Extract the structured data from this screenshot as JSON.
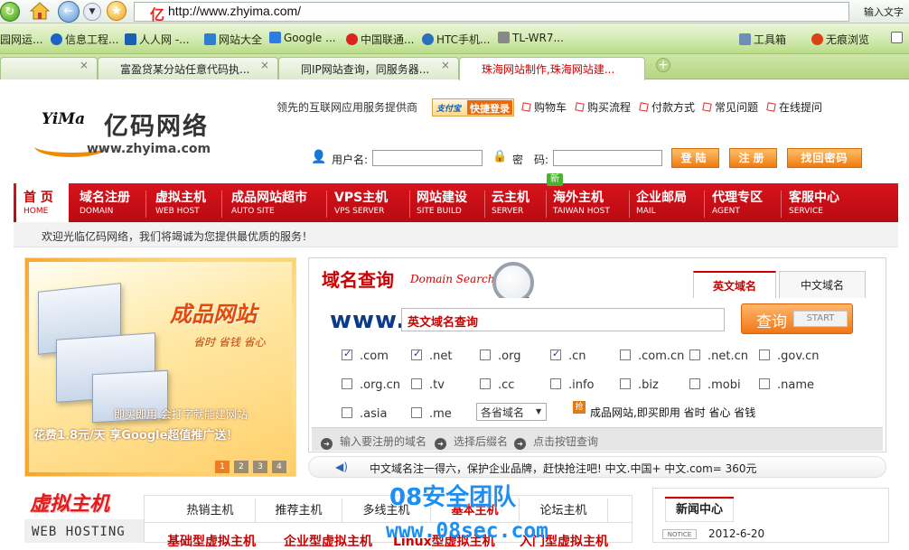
{
  "browser": {
    "url_logo": "亿",
    "url": "http://www.zhyima.com/",
    "search_hint": "输入文字",
    "bookmarks": [
      {
        "label": "园网运...",
        "color": "#2f8fd6"
      },
      {
        "label": "信息工程...",
        "color": "#1d62c6"
      },
      {
        "label": "人人网 -...",
        "color": "#1a5fb4"
      },
      {
        "label": "网站大全",
        "color": "#2d7fd0"
      },
      {
        "label": "Google ...",
        "color": "#2f7be6"
      },
      {
        "label": "中国联通...",
        "color": "#d9251d"
      },
      {
        "label": "HTC手机...",
        "color": "#2b6fbf"
      },
      {
        "label": "TL-WR7...",
        "color": "#888888"
      },
      {
        "label": "工具箱",
        "color": "#6e8fb3"
      },
      {
        "label": "无痕浏览",
        "color": "#d84315"
      }
    ],
    "tabs": [
      {
        "label": "",
        "active": false
      },
      {
        "label": "富盈贷某分站任意代码执...",
        "active": false
      },
      {
        "label": "同IP网站查询，同服务器...",
        "active": false
      },
      {
        "label": "珠海网站制作,珠海网站建...",
        "active": true
      }
    ],
    "tab_close": "×",
    "new_tab": "+"
  },
  "header": {
    "logo_mark": "YiMa",
    "logo_name": "亿码网络",
    "logo_url": "www.zhyima.com",
    "tagline": "领先的互联网应用服务提供商",
    "alipay_brand": "支付宝",
    "alipay_label": "快捷登录",
    "links": [
      "购物车",
      "购买流程",
      "付款方式",
      "常见问题",
      "在线提问"
    ],
    "username_label": "用户名:",
    "password_label": "密　码:",
    "login_button": "登陆",
    "register_button": "注册",
    "recover_button": "找回密码"
  },
  "nav": {
    "new_badge": "新",
    "items": [
      {
        "cn": "首 页",
        "en": "HOME"
      },
      {
        "cn": "域名注册",
        "en": "DOMAIN"
      },
      {
        "cn": "虚拟主机",
        "en": "WEB HOST"
      },
      {
        "cn": "成品网站超市",
        "en": "AUTO SITE"
      },
      {
        "cn": "VPS主机",
        "en": "VPS SERVER"
      },
      {
        "cn": "网站建设",
        "en": "SITE BUILD"
      },
      {
        "cn": "云主机",
        "en": "SERVER"
      },
      {
        "cn": "海外主机",
        "en": "TAIWAN HOST"
      },
      {
        "cn": "企业邮局",
        "en": "MAIL"
      },
      {
        "cn": "代理专区",
        "en": "AGENT"
      },
      {
        "cn": "客服中心",
        "en": "SERVICE"
      }
    ]
  },
  "welcome": "欢迎光临亿码网络，我们将竭诚为您提供最优质的服务！",
  "banner": {
    "title": "成品网站",
    "tagline": "省时 省钱 省心",
    "line1": "即买即用 会打字就能建网站",
    "line2": "花费1.8元/天 享Google超值推广送！",
    "pages": [
      "1",
      "2",
      "3",
      "4"
    ]
  },
  "domain": {
    "title": "域名查询",
    "title_en": "Domain Search",
    "tabs": [
      "英文域名",
      "中文域名"
    ],
    "prefix": "www.",
    "input_value": "英文域名查询",
    "query_cn": "查询",
    "query_en": "START",
    "tlds": [
      {
        "name": ".com",
        "checked": true
      },
      {
        "name": ".net",
        "checked": true
      },
      {
        "name": ".org",
        "checked": false
      },
      {
        "name": ".cn",
        "checked": true
      },
      {
        "name": ".com.cn",
        "checked": false
      },
      {
        "name": ".net.cn",
        "checked": false
      },
      {
        "name": ".gov.cn",
        "checked": false
      },
      {
        "name": ".org.cn",
        "checked": false
      },
      {
        "name": ".tv",
        "checked": false
      },
      {
        "name": ".cc",
        "checked": false
      },
      {
        "name": ".info",
        "checked": false
      },
      {
        "name": ".biz",
        "checked": false
      },
      {
        "name": ".mobi",
        "checked": false
      },
      {
        "name": ".name",
        "checked": false
      },
      {
        "name": ".asia",
        "checked": false
      },
      {
        "name": ".me",
        "checked": false
      }
    ],
    "region_select": "各省域名",
    "promo_icon": "抢",
    "promo_text": "成品网站,即买即用 省时 省心 省钱",
    "steps": [
      "输入要注册的域名",
      "选择后缀名",
      "点击按钮查询"
    ]
  },
  "notice": "中文域名注一得六，保护企业品牌，赶快抢注吧! 中文.中国+ 中文.com= 360元",
  "hosting": {
    "title": "虚拟主机",
    "title_en": "WEB HOSTING",
    "tabs": [
      "热销主机",
      "推荐主机",
      "多线主机",
      "基本主机",
      "论坛主机"
    ],
    "active_tab": 3,
    "products": [
      "基础型虚拟主机",
      "企业型虚拟主机",
      "Linux型虚拟主机",
      "入门型虚拟主机"
    ]
  },
  "news": {
    "title": "新闻中心",
    "badge": "NOTICE",
    "date": "2012-6-20"
  },
  "watermark": {
    "line1": "08安全团队",
    "line2": "www.08sec.com"
  },
  "colors": {
    "brand_red": "#c00000",
    "accent_orange": "#f07616",
    "nav_red": "#c8101a",
    "watermark_blue": "#1b8ff3"
  }
}
